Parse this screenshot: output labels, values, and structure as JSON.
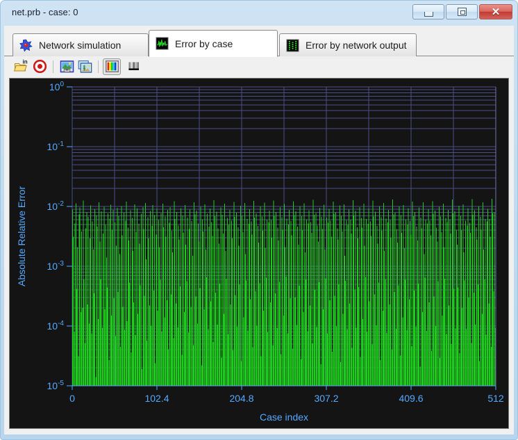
{
  "window": {
    "title": "net.prb - case: 0",
    "controls": {
      "minimize": "Minimize",
      "restore": "Restore",
      "close": "Close"
    }
  },
  "tabs": [
    {
      "label": "Network simulation",
      "icon": "network-burst-icon",
      "active": false
    },
    {
      "label": "Error by case",
      "icon": "waveform-icon",
      "active": true
    },
    {
      "label": "Error by network output",
      "icon": "dotted-bars-icon",
      "active": false
    }
  ],
  "toolbar": {
    "items": [
      {
        "name": "open-input-file-button",
        "icon": "folder-in-icon",
        "label": "Open input file",
        "pressed": false
      },
      {
        "name": "target-button",
        "icon": "red-target-icon",
        "label": "Target",
        "pressed": false
      },
      {
        "name": "save-image-button",
        "icon": "save-image-icon",
        "label": "Save image",
        "pressed": false
      },
      {
        "name": "copy-image-button",
        "icon": "copy-image-icon",
        "label": "Copy image",
        "pressed": false
      },
      {
        "name": "color-palette-button",
        "icon": "color-bars-icon",
        "label": "Color palette",
        "pressed": true
      },
      {
        "name": "grayscale-palette-button",
        "icon": "gray-bars-icon",
        "label": "Grayscale palette",
        "pressed": false
      }
    ]
  },
  "chart_data": {
    "type": "bar",
    "title": "",
    "xlabel": "Case index",
    "ylabel": "Absolute Relative Error",
    "yscale": "log",
    "xscale": "linear",
    "xlim": [
      0,
      512
    ],
    "ylim": [
      1e-05,
      1
    ],
    "grid": true,
    "legend": null,
    "background": "#141414",
    "grid_color": "#4b4f86",
    "series_color": "#1ecc1e",
    "axis_text_color": "#55aaff",
    "xticks": [
      0,
      102.4,
      204.8,
      307.2,
      409.6,
      512
    ],
    "xtick_labels": [
      "0",
      "102.4",
      "204.8",
      "307.2",
      "409.6",
      "512"
    ],
    "yticks": [
      1e-05,
      0.0001,
      0.001,
      0.01,
      0.1,
      1
    ],
    "ytick_labels": [
      "10-5",
      "10-4",
      "10-3",
      "10-2",
      "10-1",
      "100"
    ],
    "ytick_mantissa": "10",
    "ytick_exponents": [
      "-5",
      "-4",
      "-3",
      "-2",
      "-1",
      "0"
    ],
    "n_cases": 512,
    "description": "Absolute relative error per case plotted as dense vertical bars from the bottom of the log axis; most values fall between 1e-5 and 2e-2.",
    "values": [
      0.0089,
      0.0031,
      8e-05,
      0.0052,
      0.0113,
      0.00042,
      0.0021,
      3.1e-05,
      0.0074,
      0.0096,
      0.00017,
      0.0038,
      0.0002,
      0.0125,
      0.0006,
      5.2e-05,
      0.0043,
      0.0081,
      0.00023,
      0.0067,
      0.00011,
      0.0029,
      0.0104,
      7.6e-05,
      0.0056,
      0.0019,
      0.00035,
      0.0091,
      1.4e-05,
      0.0072,
      0.0046,
      0.00013,
      0.0118,
      0.0026,
      0.00061,
      0.0083,
      9.3e-05,
      0.0035,
      0.0099,
      0.00019,
      0.0049,
      0.0014,
      0.00044,
      0.0077,
      2.7e-05,
      0.0063,
      0.0107,
      0.00015,
      0.0041,
      0.0088,
      0.00029,
      0.0054,
      6.8e-05,
      0.0022,
      0.0095,
      0.00037,
      0.0069,
      0.0016,
      4.5e-05,
      0.0102,
      0.0033,
      0.00021,
      0.0079,
      8.6e-05,
      0.0058,
      0.0121,
      0.00012,
      0.0044,
      0.0027,
      0.00053,
      0.0086,
      3.6e-05,
      0.0064,
      0.0018,
      0.00025,
      0.0109,
      7.1e-05,
      0.0037,
      0.0093,
      0.00016,
      0.0051,
      0.0024,
      0.00048,
      0.0075,
      1.9e-05,
      0.0098,
      0.0042,
      0.00032,
      0.0115,
      0.0013,
      5.7e-05,
      0.0066,
      0.0029,
      0.00022,
      0.0084,
      0.000102,
      0.0047,
      0.0105,
      0.00039,
      0.0072,
      2.4e-05,
      0.0034,
      0.0091,
      0.00018,
      0.0059,
      0.0021,
      0.00059,
      0.0078,
      8.1e-05,
      0.0112,
      0.0045,
      0.00014,
      0.0068,
      0.0031,
      0.00027,
      0.0087,
      4.1e-05,
      0.0053,
      0.0097,
      0.00034,
      0.0039,
      0.0017,
      6.3e-05,
      0.0123,
      0.0062,
      0.00024,
      0.0081,
      9.5e-05,
      0.0048,
      0.0028,
      0.00046,
      0.0094,
      3.3e-05,
      0.0071,
      0.0036,
      0.00017,
      0.0106,
      0.0023,
      0.00056,
      0.0065,
      7.8e-05,
      0.0042,
      0.0089,
      0.00021,
      0.0057,
      0.0015,
      4.8e-05,
      0.0117,
      0.0074,
      0.00031,
      0.0085,
      0.00011,
      0.0052,
      0.0026,
      0.00043,
      0.0099,
      2.2e-05,
      0.0061,
      0.0038,
      0.00019,
      0.0108,
      0.0019,
      0.00065,
      0.0076,
      8.8e-05,
      0.0046,
      0.0092,
      0.00026,
      0.0055,
      0.0032,
      5.4e-05,
      0.0128,
      0.0069,
      0.00036,
      0.0082,
      0.000106,
      0.0043,
      0.0024,
      0.00051,
      0.0096,
      2.9e-05,
      0.0073,
      0.0035,
      0.00016,
      0.0111,
      0.0018,
      0.00062,
      0.0064,
      7.3e-05,
      0.0049,
      0.0087,
      0.00023,
      0.0058,
      0.0029,
      3.9e-05,
      0.0119,
      0.0067,
      0.00033,
      0.0079,
      9.8e-05,
      0.0045,
      0.0022,
      0.00049,
      0.0103,
      2.6e-05,
      0.0071,
      0.0037,
      0.00014,
      0.0114,
      0.0016,
      0.00058,
      0.0062,
      8.4e-05,
      0.0051,
      0.009,
      0.00028,
      0.0056,
      0.0034,
      4.4e-05,
      0.0124,
      0.0065,
      0.00038,
      0.0077,
      0.000101,
      0.0047,
      0.0025,
      0.00052,
      0.01,
      3.1e-05,
      0.0068,
      0.0039,
      0.00018,
      0.0116,
      0.002,
      0.00064,
      0.006,
      7.9e-05,
      0.0054,
      0.0085,
      0.00025,
      0.0059,
      0.003,
      4.7e-05,
      0.0126,
      0.007,
      0.00035,
      0.0081,
      9.2e-05,
      0.0044,
      0.0027,
      0.00055,
      0.0097,
      3.4e-05,
      0.0066,
      0.0041,
      0.00015,
      0.011,
      0.0021,
      0.00067,
      0.0063,
      7.6e-05,
      0.005,
      0.0088,
      0.00029,
      0.0057,
      0.0033,
      4.2e-05,
      0.0122,
      0.0072,
      0.0003,
      0.0083,
      0.000104,
      0.0046,
      0.0023,
      0.00047,
      0.0101,
      2.8e-05,
      0.0069,
      0.004,
      0.00017,
      0.0113,
      0.0017,
      0.0006,
      0.0061,
      8.2e-05,
      0.0052,
      0.0086,
      0.00022,
      0.0055,
      0.0036,
      5.1e-05,
      0.0129,
      0.0073,
      0.0004,
      0.0078,
      9.6e-05,
      0.0048,
      0.0026,
      0.00054,
      0.0095,
      2.3e-05,
      0.0067,
      0.0042,
      0.00019,
      0.0107,
      0.0019,
      0.00063,
      0.0065,
      7.5e-05,
      0.0053,
      0.0091,
      0.00027,
      0.0058,
      0.0031,
      3.7e-05,
      0.012,
      0.0075,
      0.00032,
      0.008,
      9.9e-05,
      0.0043,
      0.0028,
      0.0005,
      0.0104,
      2.5e-05,
      0.007,
      0.0038,
      0.00016,
      0.0109,
      0.0015,
      0.00057,
      0.0059,
      8.7e-05,
      0.0049,
      0.0089,
      0.00024,
      0.006,
      0.0035,
      4.3e-05,
      0.0127,
      0.0071,
      0.00041,
      0.0084,
      9.4e-05,
      0.0045,
      0.0029,
      0.00045,
      0.0098,
      3e-05,
      0.0064,
      0.0044,
      0.00013,
      0.0112,
      0.0022,
      0.00066,
      0.0062,
      8e-05,
      0.0051,
      0.0092,
      0.00026,
      0.0056,
      0.0032,
      4.9e-05,
      0.0125,
      0.0068,
      0.00034,
      0.0082,
      0.000103,
      0.0047,
      0.0024,
      0.00053,
      0.0102,
      2.7e-05,
      0.0066,
      0.0039,
      0.00018,
      0.0115,
      0.0018,
      0.00061,
      0.0063,
      7.7e-05,
      0.0054,
      0.0087,
      0.00023,
      0.0059,
      0.003,
      4e-05,
      0.013,
      0.0074,
      0.00037,
      0.0079,
      9e-05,
      0.0042,
      0.0025,
      0.00048,
      0.01,
      3.2e-05,
      0.0072,
      0.0036,
      0.00014,
      0.0106,
      0.002,
      0.00059,
      0.0061,
      8.5e-05,
      0.005,
      0.0093,
      0.00028,
      0.0057,
      0.0034,
      4.6e-05,
      0.0121,
      0.0069,
      0.00039,
      0.0081,
      9.7e-05,
      0.0046,
      0.0027,
      0.00051,
      0.0096,
      2.1e-05,
      0.0065,
      0.0043,
      0.00017,
      0.0118,
      0.0016,
      0.00064,
      0.006,
      8.3e-05,
      0.0052,
      0.009,
      0.00025,
      0.0058,
      0.0033,
      3.8e-05,
      0.0123,
      0.0076,
      0.00031,
      0.0085,
      0.0001,
      0.0044,
      0.0026,
      0.00056,
      0.0099,
      2.9e-05,
      0.0068,
      0.0037,
      0.00015,
      0.0111,
      0.0021,
      0.00062,
      0.0064,
      7.4e-05,
      0.0055,
      0.0088,
      0.00022,
      0.0061,
      0.0035,
      5e-05,
      0.0131,
      0.0077,
      0.00042,
      0.0083,
      9.1e-05,
      0.0041,
      0.0023,
      0.00044,
      0.0103,
      3.5e-05,
      0.007,
      0.004,
      0.0002,
      0.0108,
      0.0017,
      0.00058,
      0.0058,
      8.9e-05,
      0.0048,
      0.0094,
      0.0003,
      0.0053,
      0.0036,
      5.2e-05,
      0.0132,
      0.0073,
      0.00036,
      0.0086,
      0.000105,
      0.0045,
      0.0028,
      0.00049,
      0.0101,
      2.6e-05,
      0.0067,
      0.0041,
      0.00016,
      0.0117,
      0.0019,
      0.0006,
      0.0062,
      7.2e-05,
      0.0056,
      0.0091,
      0.00024,
      0.0062,
      0.0031,
      4.5e-05,
      0.0134,
      0.0078,
      0.00038,
      0.008,
      9.3e-05
    ]
  }
}
